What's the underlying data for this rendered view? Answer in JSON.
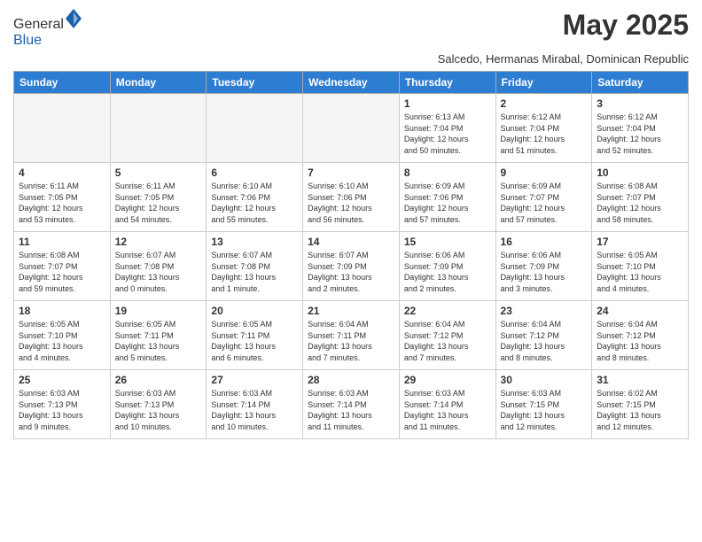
{
  "header": {
    "logo_general": "General",
    "logo_blue": "Blue",
    "month_title": "May 2025",
    "subtitle": "Salcedo, Hermanas Mirabal, Dominican Republic"
  },
  "days_of_week": [
    "Sunday",
    "Monday",
    "Tuesday",
    "Wednesday",
    "Thursday",
    "Friday",
    "Saturday"
  ],
  "weeks": [
    [
      {
        "day": "",
        "info": ""
      },
      {
        "day": "",
        "info": ""
      },
      {
        "day": "",
        "info": ""
      },
      {
        "day": "",
        "info": ""
      },
      {
        "day": "1",
        "info": "Sunrise: 6:13 AM\nSunset: 7:04 PM\nDaylight: 12 hours\nand 50 minutes."
      },
      {
        "day": "2",
        "info": "Sunrise: 6:12 AM\nSunset: 7:04 PM\nDaylight: 12 hours\nand 51 minutes."
      },
      {
        "day": "3",
        "info": "Sunrise: 6:12 AM\nSunset: 7:04 PM\nDaylight: 12 hours\nand 52 minutes."
      }
    ],
    [
      {
        "day": "4",
        "info": "Sunrise: 6:11 AM\nSunset: 7:05 PM\nDaylight: 12 hours\nand 53 minutes."
      },
      {
        "day": "5",
        "info": "Sunrise: 6:11 AM\nSunset: 7:05 PM\nDaylight: 12 hours\nand 54 minutes."
      },
      {
        "day": "6",
        "info": "Sunrise: 6:10 AM\nSunset: 7:06 PM\nDaylight: 12 hours\nand 55 minutes."
      },
      {
        "day": "7",
        "info": "Sunrise: 6:10 AM\nSunset: 7:06 PM\nDaylight: 12 hours\nand 56 minutes."
      },
      {
        "day": "8",
        "info": "Sunrise: 6:09 AM\nSunset: 7:06 PM\nDaylight: 12 hours\nand 57 minutes."
      },
      {
        "day": "9",
        "info": "Sunrise: 6:09 AM\nSunset: 7:07 PM\nDaylight: 12 hours\nand 57 minutes."
      },
      {
        "day": "10",
        "info": "Sunrise: 6:08 AM\nSunset: 7:07 PM\nDaylight: 12 hours\nand 58 minutes."
      }
    ],
    [
      {
        "day": "11",
        "info": "Sunrise: 6:08 AM\nSunset: 7:07 PM\nDaylight: 12 hours\nand 59 minutes."
      },
      {
        "day": "12",
        "info": "Sunrise: 6:07 AM\nSunset: 7:08 PM\nDaylight: 13 hours\nand 0 minutes."
      },
      {
        "day": "13",
        "info": "Sunrise: 6:07 AM\nSunset: 7:08 PM\nDaylight: 13 hours\nand 1 minute."
      },
      {
        "day": "14",
        "info": "Sunrise: 6:07 AM\nSunset: 7:09 PM\nDaylight: 13 hours\nand 2 minutes."
      },
      {
        "day": "15",
        "info": "Sunrise: 6:06 AM\nSunset: 7:09 PM\nDaylight: 13 hours\nand 2 minutes."
      },
      {
        "day": "16",
        "info": "Sunrise: 6:06 AM\nSunset: 7:09 PM\nDaylight: 13 hours\nand 3 minutes."
      },
      {
        "day": "17",
        "info": "Sunrise: 6:05 AM\nSunset: 7:10 PM\nDaylight: 13 hours\nand 4 minutes."
      }
    ],
    [
      {
        "day": "18",
        "info": "Sunrise: 6:05 AM\nSunset: 7:10 PM\nDaylight: 13 hours\nand 4 minutes."
      },
      {
        "day": "19",
        "info": "Sunrise: 6:05 AM\nSunset: 7:11 PM\nDaylight: 13 hours\nand 5 minutes."
      },
      {
        "day": "20",
        "info": "Sunrise: 6:05 AM\nSunset: 7:11 PM\nDaylight: 13 hours\nand 6 minutes."
      },
      {
        "day": "21",
        "info": "Sunrise: 6:04 AM\nSunset: 7:11 PM\nDaylight: 13 hours\nand 7 minutes."
      },
      {
        "day": "22",
        "info": "Sunrise: 6:04 AM\nSunset: 7:12 PM\nDaylight: 13 hours\nand 7 minutes."
      },
      {
        "day": "23",
        "info": "Sunrise: 6:04 AM\nSunset: 7:12 PM\nDaylight: 13 hours\nand 8 minutes."
      },
      {
        "day": "24",
        "info": "Sunrise: 6:04 AM\nSunset: 7:12 PM\nDaylight: 13 hours\nand 8 minutes."
      }
    ],
    [
      {
        "day": "25",
        "info": "Sunrise: 6:03 AM\nSunset: 7:13 PM\nDaylight: 13 hours\nand 9 minutes."
      },
      {
        "day": "26",
        "info": "Sunrise: 6:03 AM\nSunset: 7:13 PM\nDaylight: 13 hours\nand 10 minutes."
      },
      {
        "day": "27",
        "info": "Sunrise: 6:03 AM\nSunset: 7:14 PM\nDaylight: 13 hours\nand 10 minutes."
      },
      {
        "day": "28",
        "info": "Sunrise: 6:03 AM\nSunset: 7:14 PM\nDaylight: 13 hours\nand 11 minutes."
      },
      {
        "day": "29",
        "info": "Sunrise: 6:03 AM\nSunset: 7:14 PM\nDaylight: 13 hours\nand 11 minutes."
      },
      {
        "day": "30",
        "info": "Sunrise: 6:03 AM\nSunset: 7:15 PM\nDaylight: 13 hours\nand 12 minutes."
      },
      {
        "day": "31",
        "info": "Sunrise: 6:02 AM\nSunset: 7:15 PM\nDaylight: 13 hours\nand 12 minutes."
      }
    ]
  ]
}
